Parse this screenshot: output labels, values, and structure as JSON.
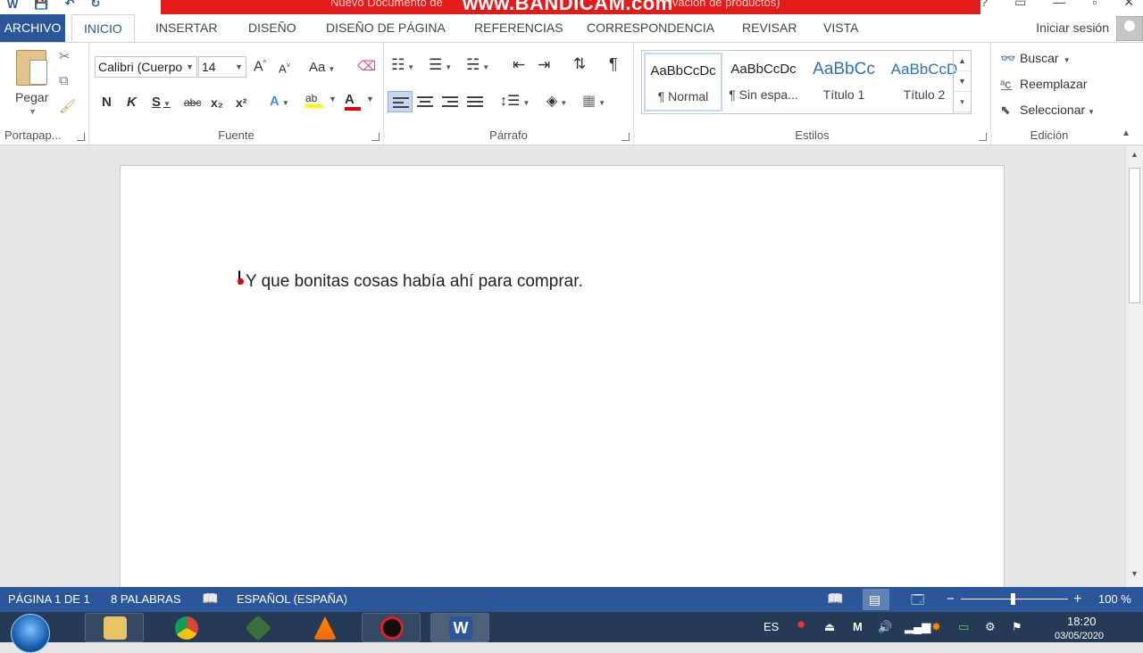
{
  "title_bar": {
    "doc_title": "Nuevo Documento de",
    "watermark": "www.BANDICAM.com",
    "doc_title_suffix": "ivación de productos)",
    "qat_save": "💾",
    "qat_undo": "↶",
    "qat_redo": "↻"
  },
  "tabs": {
    "file": "ARCHIVO",
    "items": [
      "INICIO",
      "INSERTAR",
      "DISEÑO",
      "DISEÑO DE PÁGINA",
      "REFERENCIAS",
      "CORRESPONDENCIA",
      "REVISAR",
      "VISTA"
    ],
    "signin": "Iniciar sesión"
  },
  "ribbon": {
    "clipboard": {
      "paste": "Pegar",
      "label": "Portapap..."
    },
    "font": {
      "name": "Calibri (Cuerpo",
      "size": "14",
      "grow": "A",
      "shrink": "A",
      "case": "Aa",
      "bold": "N",
      "italic": "K",
      "underline": "S",
      "strike": "abc",
      "subscript": "x₂",
      "superscript": "x²",
      "label": "Fuente"
    },
    "paragraph": {
      "label": "Párrafo",
      "pilcrow": "¶"
    },
    "styles": {
      "items": [
        {
          "sample": "AaBbCcDc",
          "name": "¶ Normal"
        },
        {
          "sample": "AaBbCcDc",
          "name": "¶ Sin espa..."
        },
        {
          "sample": "AaBbCc",
          "name": "Título 1"
        },
        {
          "sample": "AaBbCcD",
          "name": "Título 2"
        }
      ],
      "label": "Estilos"
    },
    "editing": {
      "find": "Buscar",
      "replace": "Reemplazar",
      "select": "Seleccionar",
      "label": "Edición"
    }
  },
  "document": {
    "text": "Y que bonitas cosas había ahí para comprar."
  },
  "status": {
    "page": "PÁGINA 1 DE 1",
    "words": "8 PALABRAS",
    "language": "ESPAÑOL (ESPAÑA)",
    "zoom": "100 %",
    "zoom_minus": "−",
    "zoom_plus": "+"
  },
  "taskbar": {
    "lang": "ES",
    "time": "18:20",
    "date": "03/05/2020"
  },
  "colors": {
    "accent": "#2b579a",
    "banner": "#e31b1b",
    "highlight": "#ffff00",
    "font_color": "#e00000"
  }
}
